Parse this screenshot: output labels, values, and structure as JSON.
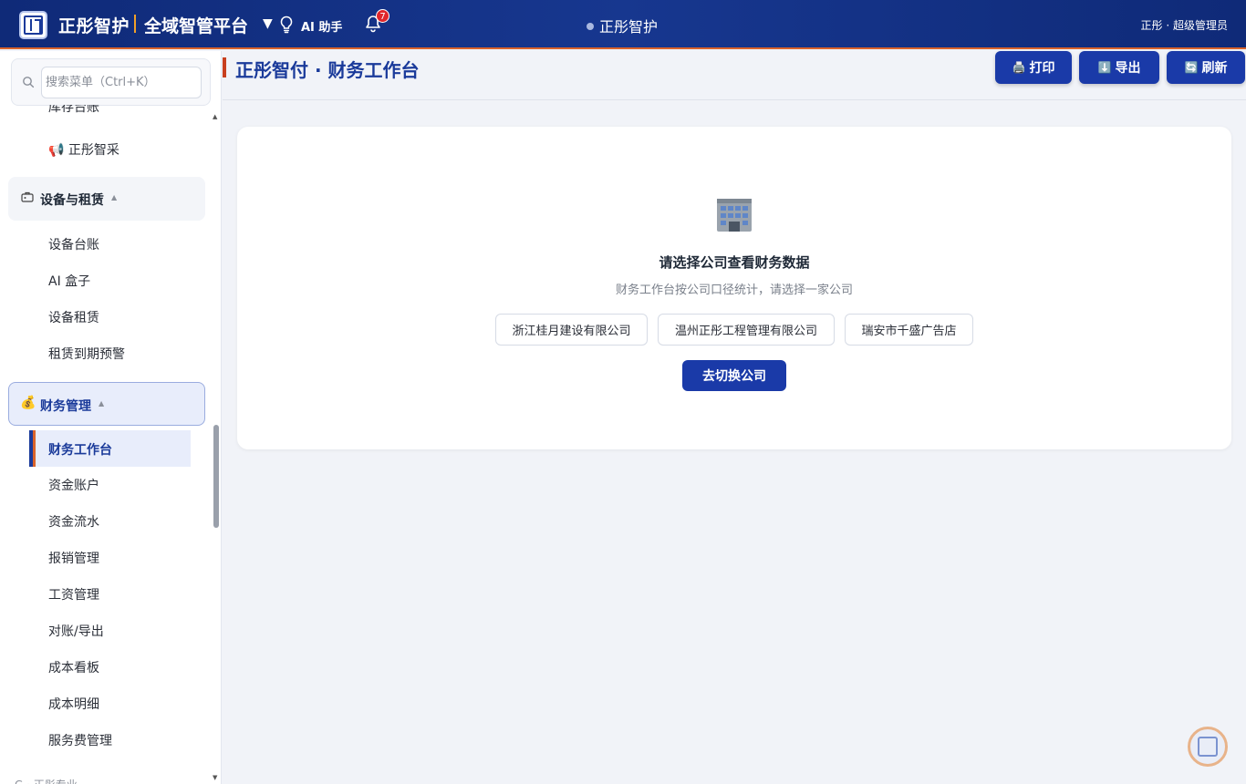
{
  "header": {
    "brand": "正彤智护",
    "platform": "全域智管平台",
    "caret": "▼",
    "ai_assistant": "AI 助手",
    "notifications_count": "7",
    "center_title": "正彤智护",
    "user": "正彤 · 超级管理员"
  },
  "sidebar": {
    "search_placeholder": "搜索菜单（Ctrl+K）",
    "partial_top_item": "库存台账",
    "item_procurement": "📢 正彤智采",
    "group_equipment": {
      "label": "设备与租赁",
      "caret": "▲"
    },
    "equipment_items": [
      "设备台账",
      "AI 盒子",
      "设备租赁",
      "租赁到期预警"
    ],
    "group_finance": {
      "icon": "💰",
      "label": "财务管理",
      "caret": "▲"
    },
    "finance_items": [
      "财务工作台",
      "资金账户",
      "资金流水",
      "报销管理",
      "工资管理",
      "对账/导出",
      "成本看板",
      "成本明细",
      "服务费管理"
    ],
    "partial_bottom_item": "G · 正彤专业"
  },
  "main": {
    "title": "正彤智付 · 财务工作台",
    "buttons": {
      "print": {
        "icon": "🖨️",
        "label": "打印"
      },
      "export": {
        "icon": "⬇️",
        "label": "导出"
      },
      "refresh": {
        "icon": "🔄",
        "label": "刷新"
      }
    },
    "empty_state": {
      "title": "请选择公司查看财务数据",
      "subtitle": "财务工作台按公司口径统计，请选择一家公司",
      "companies": [
        "浙江桂月建设有限公司",
        "温州正彤工程管理有限公司",
        "瑞安市千盛广告店"
      ],
      "switch_button": "去切换公司"
    }
  },
  "colors": {
    "header_bg": "#17378f",
    "header_accent": "#d9632b",
    "primary": "#1a3aa8",
    "active_bg": "#e8edfb",
    "badge": "#e0262b"
  }
}
